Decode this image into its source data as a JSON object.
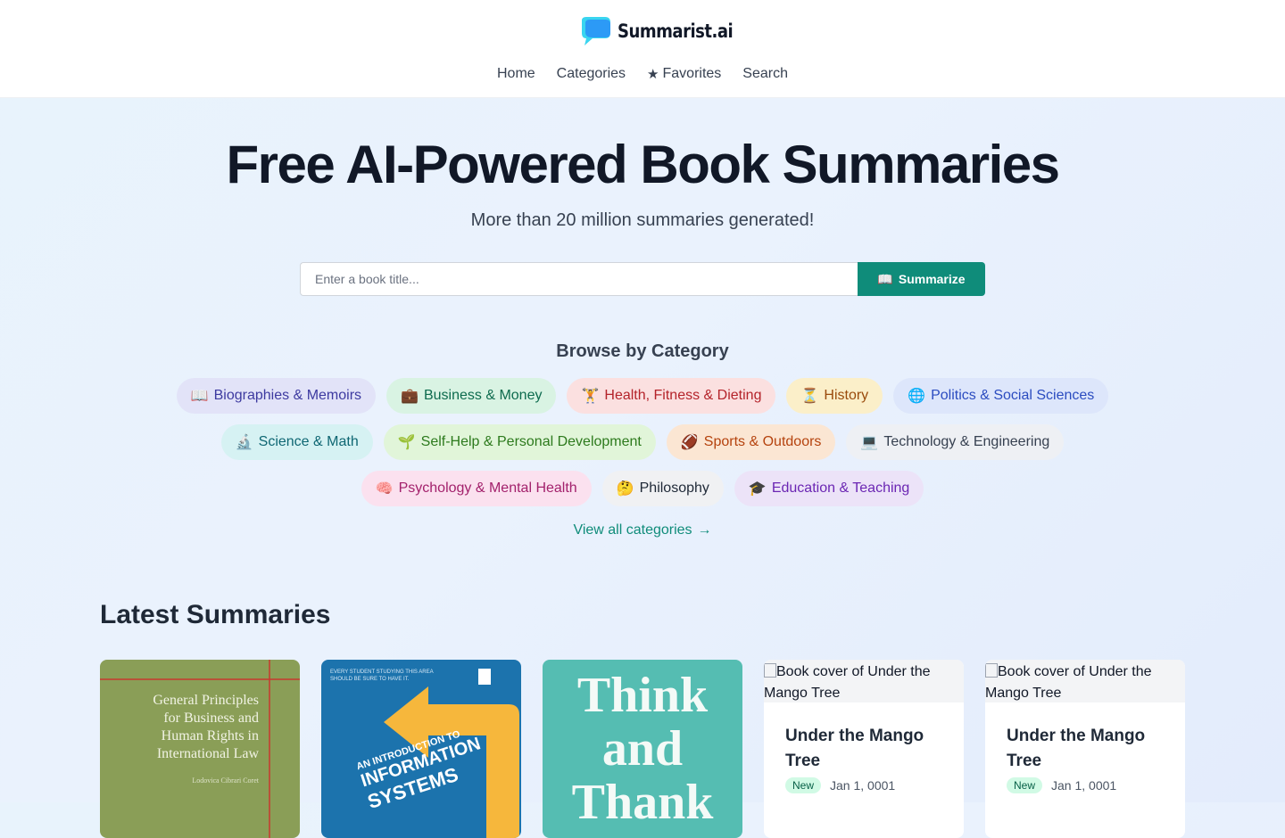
{
  "brand": {
    "name": "Summarist.ai"
  },
  "nav": {
    "home": "Home",
    "categories": "Categories",
    "favorites": "Favorites",
    "favorites_icon": "★",
    "search": "Search"
  },
  "hero": {
    "title": "Free AI-Powered Book Summaries",
    "subtitle": "More than 20 million summaries generated!"
  },
  "search": {
    "placeholder": "Enter a book title...",
    "button_icon": "📖",
    "button_label": "Summarize"
  },
  "browse": {
    "title": "Browse by Category",
    "rows": [
      [
        {
          "emoji": "📖",
          "label": "Biographies & Memoirs",
          "bg": "#e2e3f8",
          "fg": "#3d3aa0"
        },
        {
          "emoji": "💼",
          "label": "Business & Money",
          "bg": "#d9f3e3",
          "fg": "#0d6b4e"
        },
        {
          "emoji": "🏋️",
          "label": "Health, Fitness & Dieting",
          "bg": "#fbe0e0",
          "fg": "#b4232a"
        },
        {
          "emoji": "⏳",
          "label": "History",
          "bg": "#fbefc9",
          "fg": "#9a4b0c"
        },
        {
          "emoji": "🌐",
          "label": "Politics & Social Sciences",
          "bg": "#dde6fb",
          "fg": "#2b4cc0"
        }
      ],
      [
        {
          "emoji": "🔬",
          "label": "Science & Math",
          "bg": "#d6f2f3",
          "fg": "#0f6773"
        },
        {
          "emoji": "🌱",
          "label": "Self-Help & Personal Development",
          "bg": "#e1f5d9",
          "fg": "#2d7a1d"
        },
        {
          "emoji": "🏈",
          "label": "Sports & Outdoors",
          "bg": "#fbe6d3",
          "fg": "#b5430e"
        },
        {
          "emoji": "💻",
          "label": "Technology & Engineering",
          "bg": "#eef0f4",
          "fg": "#374151"
        }
      ],
      [
        {
          "emoji": "🧠",
          "label": "Psychology & Mental Health",
          "bg": "#fbe1ef",
          "fg": "#a3216c"
        },
        {
          "emoji": "🤔",
          "label": "Philosophy",
          "bg": "#f0f1f3",
          "fg": "#1f2937"
        },
        {
          "emoji": "🎓",
          "label": "Education & Teaching",
          "bg": "#ece3f8",
          "fg": "#6b26b3"
        }
      ]
    ],
    "view_all": "View all categories",
    "view_all_icon": "→"
  },
  "latest": {
    "title": "Latest Summaries",
    "cards": [
      {
        "cover_lines": [
          "General Principles",
          "for Business and",
          "Human Rights in",
          "International Law"
        ],
        "cover_author": "Lodovica Cibrari Coret"
      },
      {
        "cover_top": "EVERY STUDENT STUDYING THIS AREA SHOULD BE SURE TO HAVE IT.",
        "cover_lines": [
          "AN INTRODUCTION TO",
          "INFORMATION",
          "SYSTEMS"
        ]
      },
      {
        "cover_lines": [
          "Think",
          "and",
          "Thank"
        ]
      },
      {
        "alt": "Book cover of Under the Mango Tree",
        "title": "Under the Mango Tree",
        "badge": "New",
        "date": "Jan 1, 0001"
      },
      {
        "alt": "Book cover of Under the Mango Tree",
        "title": "Under the Mango Tree",
        "badge": "New",
        "date": "Jan 1, 0001"
      }
    ]
  },
  "colors": {
    "accent": "#0f8c7a",
    "title": "#111827",
    "logo_blue": "#2a8ff7",
    "logo_cyan": "#39d5f0"
  }
}
